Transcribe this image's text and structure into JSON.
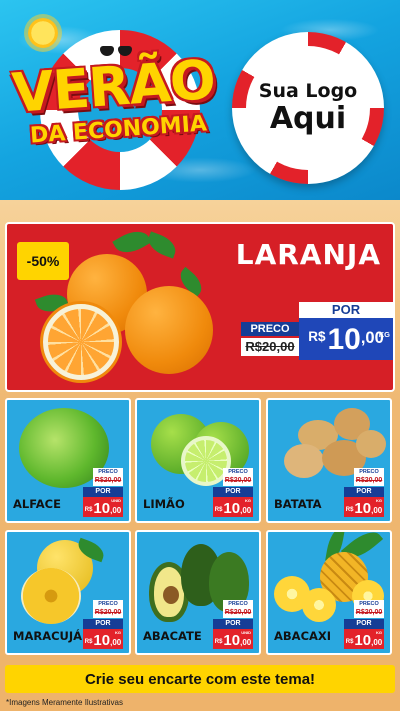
{
  "header": {
    "title_line1": "VERÃO",
    "title_line2": "DA ECONOMIA",
    "logo_line1": "Sua Logo",
    "logo_line2": "Aqui"
  },
  "featured": {
    "discount": "-50%",
    "name": "LARANJA",
    "preco_label": "PRECO",
    "old_price": "R$20,00",
    "por_label": "POR",
    "currency": "R$",
    "price_int": "10",
    "price_cents": ",00",
    "unit": "KG"
  },
  "products": [
    {
      "name": "ALFACE",
      "preco_label": "PRECO",
      "old_price": "R$20,00",
      "por_label": "POR",
      "currency": "R$",
      "price_int": "10",
      "price_cents": ",00",
      "unit": "UNID"
    },
    {
      "name": "LIMÃO",
      "preco_label": "PRECO",
      "old_price": "R$20,00",
      "por_label": "POR",
      "currency": "R$",
      "price_int": "10",
      "price_cents": ",00",
      "unit": "KG"
    },
    {
      "name": "BATATA",
      "preco_label": "PRECO",
      "old_price": "R$20,00",
      "por_label": "POR",
      "currency": "R$",
      "price_int": "10",
      "price_cents": ",00",
      "unit": "KG"
    },
    {
      "name": "MARACUJÁ",
      "preco_label": "PRECO",
      "old_price": "R$20,00",
      "por_label": "POR",
      "currency": "R$",
      "price_int": "10",
      "price_cents": ",00",
      "unit": "KG"
    },
    {
      "name": "ABACATE",
      "preco_label": "PRECO",
      "old_price": "R$20,00",
      "por_label": "POR",
      "currency": "R$",
      "price_int": "10",
      "price_cents": ",00",
      "unit": "UNID"
    },
    {
      "name": "ABACAXI",
      "preco_label": "PRECO",
      "old_price": "R$20,00",
      "por_label": "POR",
      "currency": "R$",
      "price_int": "10",
      "price_cents": ",00",
      "unit": "KG"
    }
  ],
  "footer": {
    "cta": "Crie seu encarte com este tema!",
    "disclaimer": "*Imagens Meramente Ilustrativas"
  },
  "colors": {
    "pool_blue": "#14a4e0",
    "featured_red": "#d61f26",
    "card_blue": "#2aa8e0",
    "price_red": "#e3222a",
    "price_blue": "#1f47b8",
    "yellow": "#ffd400"
  }
}
